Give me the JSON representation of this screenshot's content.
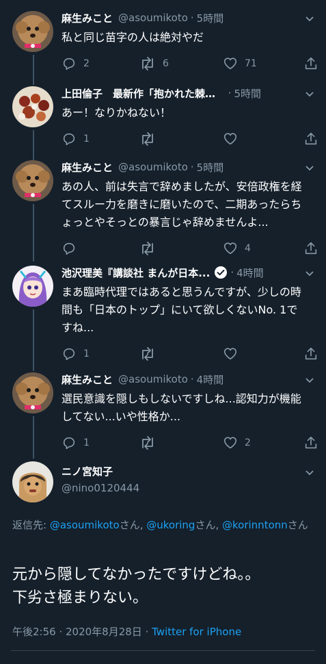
{
  "colors": {
    "background": "#15202b",
    "secondary_text": "#8899a6",
    "link": "#1da1f2",
    "thread_line": "#3d5466"
  },
  "tweets": [
    {
      "name": "麻生みこと",
      "handle": "@asoumikoto",
      "separator": "·",
      "time": "5時間",
      "lines": [
        "私と同じ苗字の人は絶対やだ"
      ],
      "reply_count": "2",
      "retweet_count": "6",
      "like_count": "71",
      "avatar": "poodle-avatar"
    },
    {
      "name": "上田倫子　最新作「抱かれた棘と...",
      "handle": "",
      "separator": "·",
      "time": "5時間",
      "lines": [
        "あー！なりかねない！"
      ],
      "reply_count": "1",
      "retweet_count": "",
      "like_count": "",
      "avatar": "food-avatar"
    },
    {
      "name": "麻生みこと",
      "handle": "@asoumikoto",
      "separator": "·",
      "time": "5時間",
      "lines": [
        "あの人、前は失言で辞めましたが、安倍政権を経",
        "てスルー力を磨きに磨いたので、二期あったらち",
        "ょっとやそっとの暴言じゃ辞めませんよ..."
      ],
      "reply_count": "",
      "retweet_count": "",
      "like_count": "4",
      "avatar": "poodle-avatar"
    },
    {
      "name": "池沢理美『講談社 まんが日本...",
      "handle": "",
      "separator": "·",
      "time": "4時間",
      "verified": true,
      "lines": [
        "まあ臨時代理ではあると思うんですが、少しの時",
        "間も「日本のトップ」にいて欲しくないNo. 1で",
        "すね..."
      ],
      "reply_count": "1",
      "retweet_count": "",
      "like_count": "",
      "avatar": "anime-girl-avatar"
    },
    {
      "name": "麻生みこと",
      "handle": "@asoumikoto",
      "separator": "·",
      "time": "4時間",
      "lines": [
        "選民意識を隠しもしないですしね...認知力が機能",
        "してない...いや性格か..."
      ],
      "reply_count": "1",
      "retweet_count": "",
      "like_count": "2",
      "avatar": "poodle-avatar"
    }
  ],
  "focused": {
    "name": "ニノ宮知子",
    "handle": "@nino0120444",
    "avatar": "clay-figure-avatar",
    "reply_prefix": "返信先: ",
    "mentions": [
      "@asoumikoto",
      "@ukoring",
      "@korinntonn"
    ],
    "mention_suffix": "さん",
    "mention_sep": ", ",
    "text_lines": [
      "元から隠してなかったですけどね。。",
      "下劣さ極まりない。"
    ],
    "time": "午後2:56",
    "meta_sep": " · ",
    "date": "2020年8月28日",
    "app": "Twitter for iPhone"
  }
}
